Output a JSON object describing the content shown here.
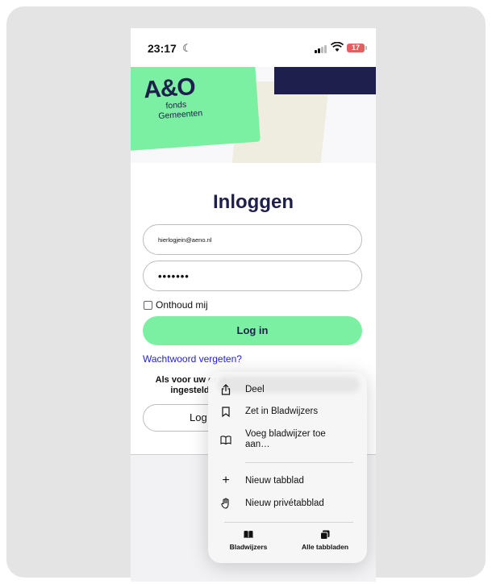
{
  "status_bar": {
    "time": "23:17",
    "battery": "17"
  },
  "header": {
    "logo_main": "A&O",
    "logo_line1": "fonds",
    "logo_line2": "Gemeenten"
  },
  "form": {
    "title": "Inloggen",
    "email_value": "hierlogjein@aeno.nl",
    "password_value": "•••••••",
    "remember_label": "Onthoud mij",
    "login_label": "Log in",
    "forgot_label": "Wachtwoord vergeten?",
    "info_text": "Als voor uw or is ingesteld,",
    "login2_label": "Log"
  },
  "context_menu": {
    "items": [
      {
        "label": "Deel",
        "icon": "share-icon"
      },
      {
        "label": "Zet in Bladwijzers",
        "icon": "bookmark-icon"
      },
      {
        "label": "Voeg bladwijzer toe aan…",
        "icon": "book-open-icon"
      },
      {
        "label": "Nieuw tabblad",
        "icon": "plus-icon"
      },
      {
        "label": "Nieuw privétabblad",
        "icon": "hand-icon"
      }
    ],
    "tabs": [
      {
        "label": "Bladwijzers",
        "icon": "book-icon"
      },
      {
        "label": "Alle tabbladen",
        "icon": "tabs-icon"
      }
    ]
  },
  "colors": {
    "brand_green": "#7bf0a2",
    "brand_navy": "#1f1f4d",
    "link_blue": "#2020e0"
  }
}
